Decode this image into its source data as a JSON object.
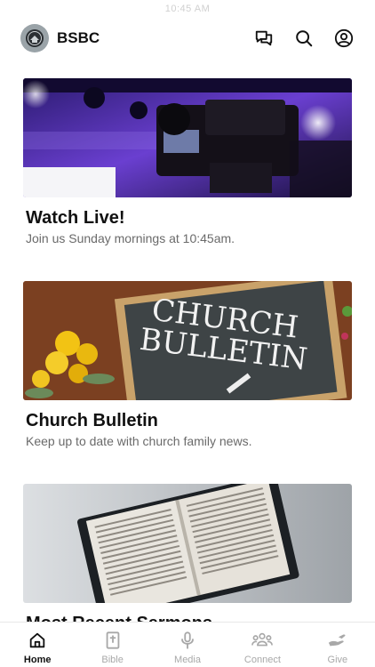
{
  "status_bar": {
    "time": "10:45 AM"
  },
  "header": {
    "title": "BSBC",
    "icons": [
      "chat-icon",
      "search-icon",
      "account-icon"
    ]
  },
  "cards": [
    {
      "title": "Watch Live!",
      "subtitle": "Join us Sunday mornings at 10:45am."
    },
    {
      "title": "Church Bulletin",
      "subtitle": "Keep up to date with church family news.",
      "image_text_line1": "CHURCH",
      "image_text_line2": "BULLETIN"
    },
    {
      "title": "Most Recent Sermons",
      "subtitle": ""
    }
  ],
  "tabbar": {
    "active": "Home",
    "tabs": [
      {
        "label": "Home",
        "icon": "home-icon"
      },
      {
        "label": "Bible",
        "icon": "bible-icon"
      },
      {
        "label": "Media",
        "icon": "microphone-icon"
      },
      {
        "label": "Connect",
        "icon": "people-icon"
      },
      {
        "label": "Give",
        "icon": "give-hand-icon"
      }
    ]
  }
}
